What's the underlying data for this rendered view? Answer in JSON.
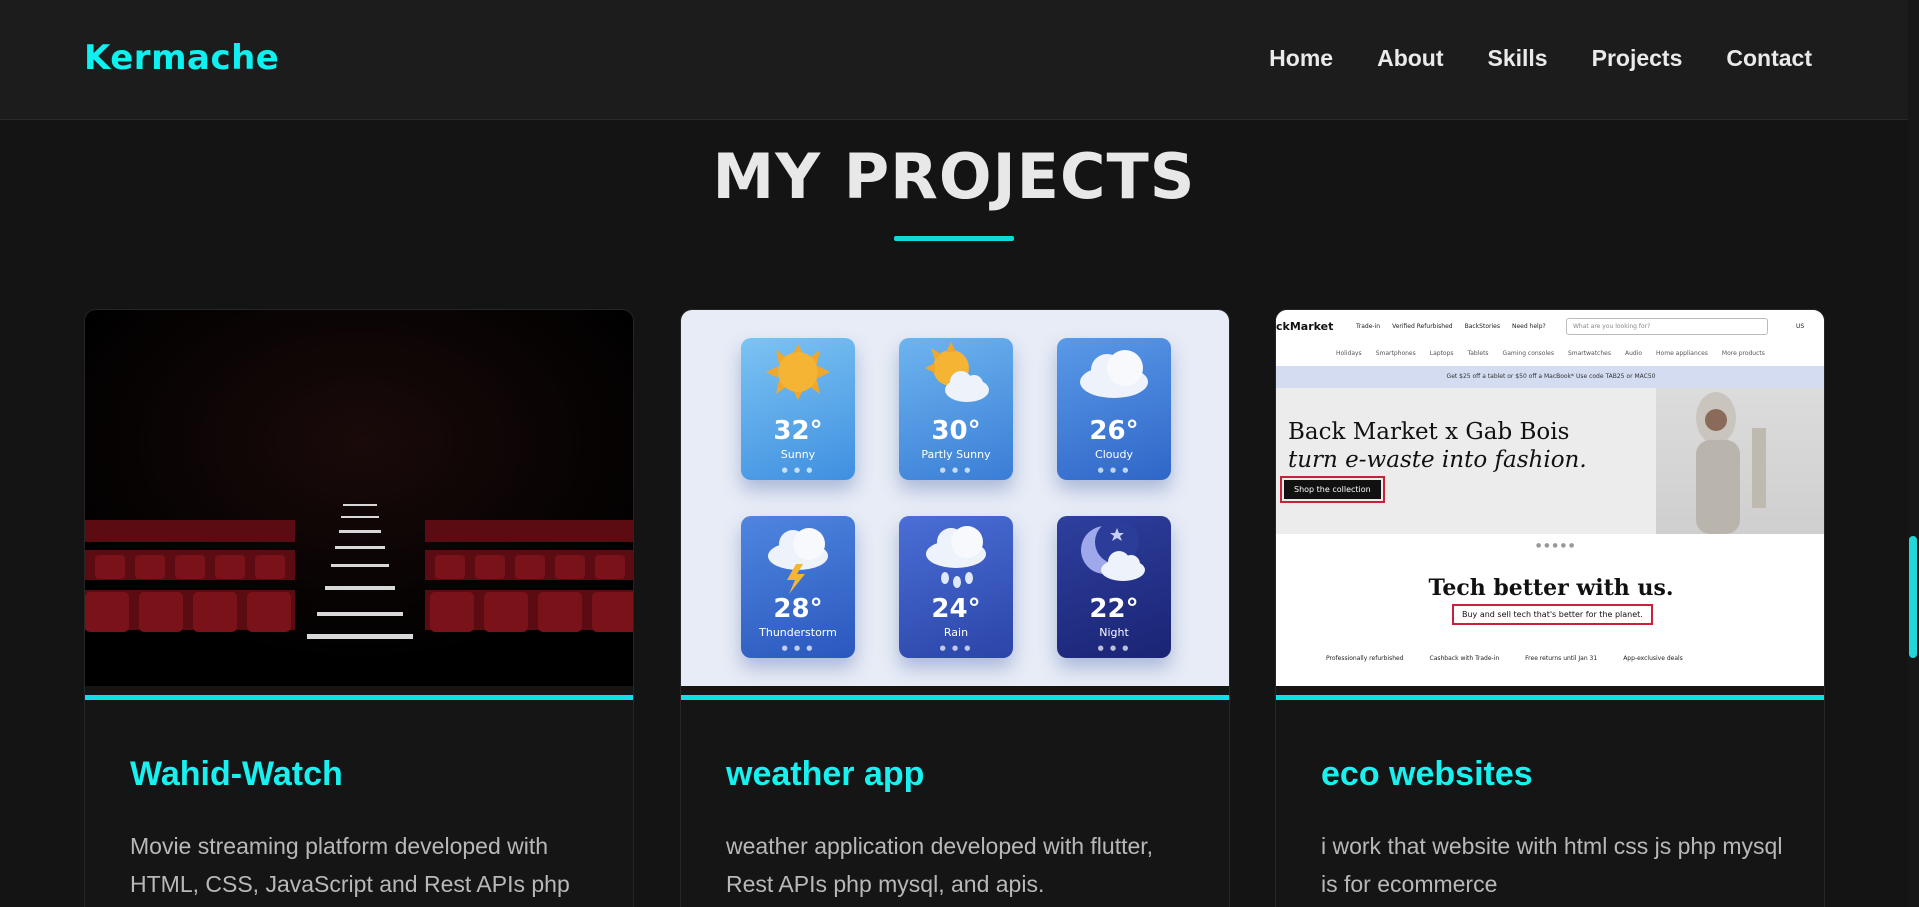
{
  "header": {
    "logo": "Kermache",
    "nav": [
      "Home",
      "About",
      "Skills",
      "Projects",
      "Contact"
    ]
  },
  "section": {
    "title": "MY PROJECTS"
  },
  "projects": [
    {
      "title": "Wahid-Watch",
      "description": "Movie streaming platform developed with HTML, CSS, JavaScript and Rest APIs php"
    },
    {
      "title": "weather app",
      "description": "weather application developed with flutter, Rest APIs php mysql, and apis.",
      "weather_cards": [
        {
          "temp": "32°",
          "label": "Sunny"
        },
        {
          "temp": "30°",
          "label": "Partly Sunny"
        },
        {
          "temp": "26°",
          "label": "Cloudy"
        },
        {
          "temp": "28°",
          "label": "Thunderstorm"
        },
        {
          "temp": "24°",
          "label": "Rain"
        },
        {
          "temp": "22°",
          "label": "Night"
        }
      ]
    },
    {
      "title": "eco websites",
      "description": "i work that website with html css js php mysql is for ecommerce",
      "screenshot": {
        "brand": "ckMarket",
        "links": [
          "Trade-in",
          "Verified Refurbished",
          "BackStories",
          "Need help?"
        ],
        "search_placeholder": "What are you looking for?",
        "region": "US",
        "categories": [
          "Holidays",
          "Smartphones",
          "Laptops",
          "Tablets",
          "Gaming consoles",
          "Smartwatches",
          "Audio",
          "Home appliances",
          "More products"
        ],
        "promo": "Get $25 off a tablet or $50 off a MacBook* Use code TAB25 or MAC50",
        "hero_line1": "Back Market x Gab Bois",
        "hero_line2": "turn e-waste into fashion.",
        "hero_button": "Shop the collection",
        "tagline": "Tech better with us.",
        "subline": "Buy and sell tech that's better for the planet.",
        "features": [
          "Professionally refurbished",
          "Cashback with Trade-in",
          "Free returns until Jan 31",
          "App-exclusive deals"
        ]
      }
    }
  ],
  "colors": {
    "accent": "#10e0e6",
    "background": "#141414",
    "header": "#1c1c1c"
  }
}
